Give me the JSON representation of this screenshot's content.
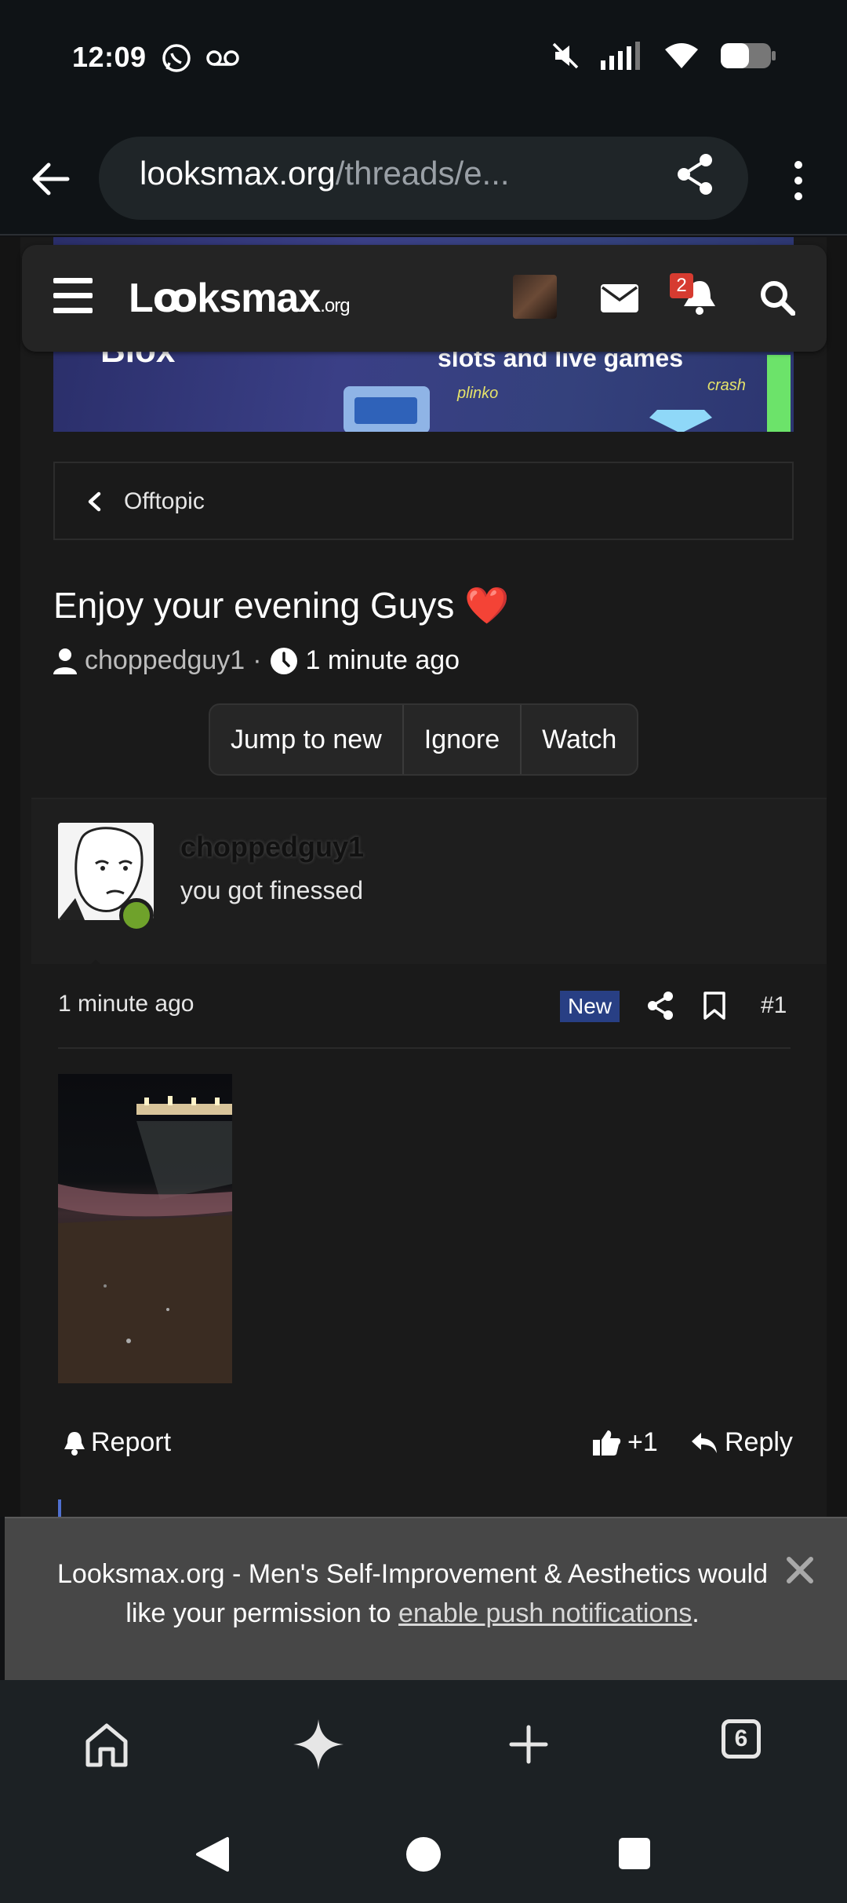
{
  "status_bar": {
    "time": "12:09",
    "left_icons": [
      "whatsapp-icon",
      "voicemail-icon"
    ],
    "right_icons": [
      "mute-icon",
      "signal-icon",
      "wifi-icon",
      "battery-icon"
    ]
  },
  "browser": {
    "url_host": "looksmax.org",
    "url_path": "/threads/e...",
    "tab_count": "6"
  },
  "ad": {
    "logo_text": "Blox",
    "headline": "slots and live games",
    "tag1": "plinko",
    "tag2": "crash"
  },
  "forum_header": {
    "logo_main": "Lꝏksmax",
    "logo_suffix": ".org",
    "notification_count": "2"
  },
  "breadcrumb": {
    "label": "Offtopic"
  },
  "thread": {
    "title": "Enjoy your evening Guys ❤️",
    "author": "choppedguy1",
    "separator": "·",
    "time": "1 minute ago",
    "buttons": {
      "jump": "Jump to new",
      "ignore": "Ignore",
      "watch": "Watch"
    }
  },
  "post": {
    "username": "choppedguy1",
    "user_title": "you got finessed",
    "time": "1 minute ago",
    "badge": "New",
    "number": "#1",
    "actions": {
      "report": "Report",
      "like": "+1",
      "reply": "Reply"
    }
  },
  "push_banner": {
    "text_before": "Looksmax.org - Men's Self-Improvement & Aesthetics would like your permission to ",
    "link_text": "enable push notifications",
    "text_after": "."
  }
}
